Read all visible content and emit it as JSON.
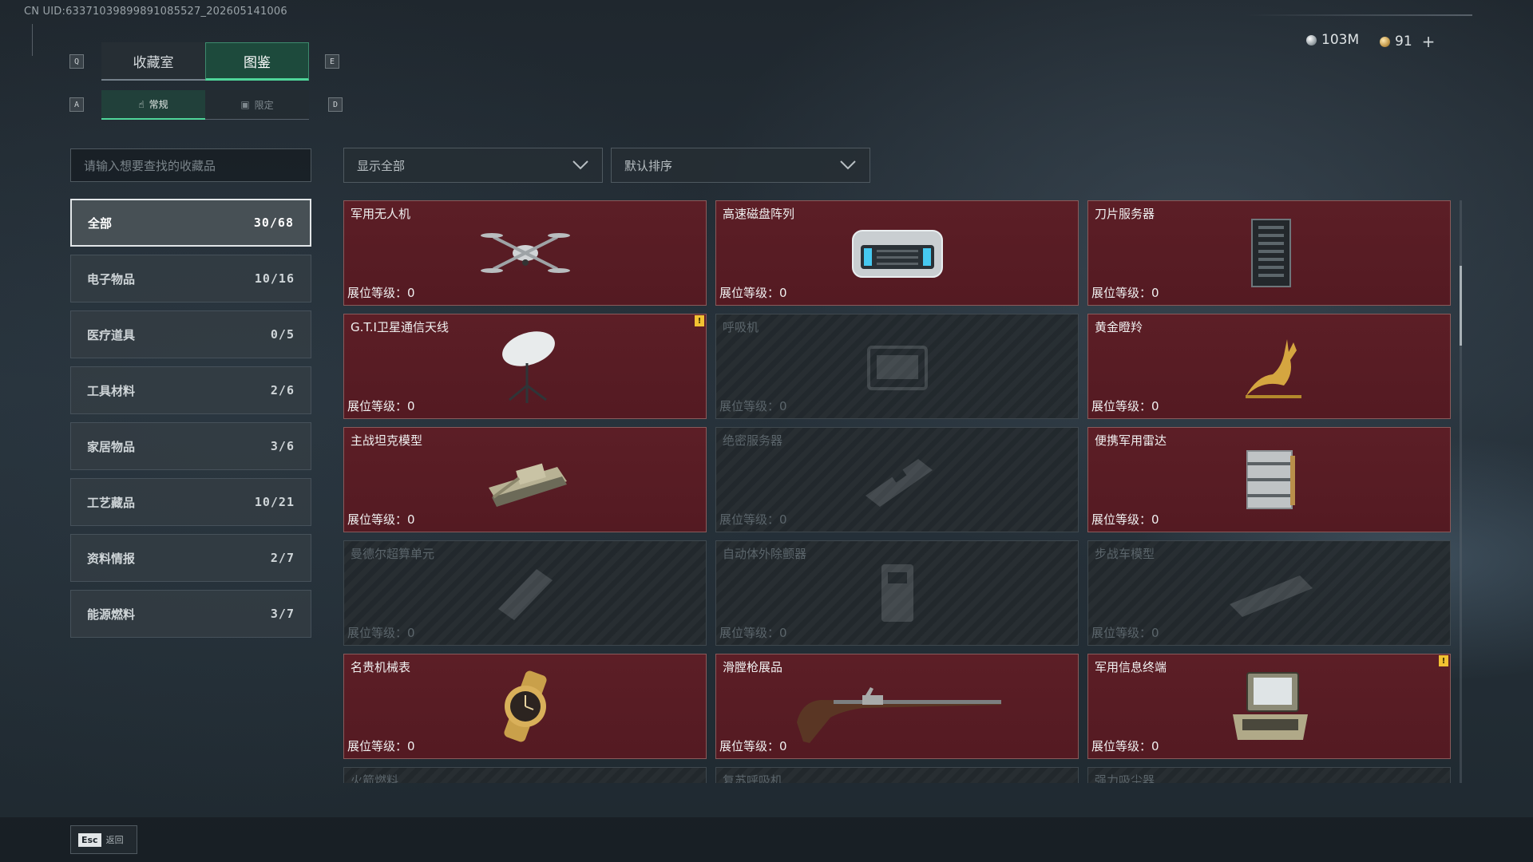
{
  "uid": "CN UID:63371039899891085527_202605141006",
  "keys": {
    "q": "Q",
    "e": "E",
    "a": "A",
    "d": "D"
  },
  "tabs": [
    {
      "label": "收藏室",
      "active": false
    },
    {
      "label": "图鉴",
      "active": true
    }
  ],
  "subtabs": [
    {
      "label": "常规",
      "icon": "hand-icon",
      "active": true
    },
    {
      "label": "限定",
      "icon": "frame-icon",
      "active": false
    }
  ],
  "currency": {
    "silver": "103M",
    "gold": "91",
    "plus": "+"
  },
  "search": {
    "placeholder": "请输入想要查找的收藏品"
  },
  "filters": {
    "display": "显示全部",
    "sort": "默认排序"
  },
  "categories": [
    {
      "label": "全部",
      "count": "30/68",
      "active": true
    },
    {
      "label": "电子物品",
      "count": "10/16",
      "active": false
    },
    {
      "label": "医疗道具",
      "count": "0/5",
      "active": false
    },
    {
      "label": "工具材料",
      "count": "2/6",
      "active": false
    },
    {
      "label": "家居物品",
      "count": "3/6",
      "active": false
    },
    {
      "label": "工艺藏品",
      "count": "10/21",
      "active": false
    },
    {
      "label": "资料情报",
      "count": "2/7",
      "active": false
    },
    {
      "label": "能源燃料",
      "count": "3/7",
      "active": false
    }
  ],
  "items": [
    {
      "name": "军用无人机",
      "level": "展位等级：0",
      "owned": true,
      "icon": "drone-icon",
      "flag": false
    },
    {
      "name": "高速磁盘阵列",
      "level": "展位等级：0",
      "owned": true,
      "icon": "disk-array-icon",
      "flag": false
    },
    {
      "name": "刀片服务器",
      "level": "展位等级：0",
      "owned": true,
      "icon": "server-icon",
      "flag": false
    },
    {
      "name": "G.T.I卫星通信天线",
      "level": "展位等级：0",
      "owned": true,
      "icon": "satellite-dish-icon",
      "flag": true
    },
    {
      "name": "呼吸机",
      "level": "展位等级：0",
      "owned": false,
      "icon": "ventilator-icon",
      "flag": false
    },
    {
      "name": "黄金瞪羚",
      "level": "展位等级：0",
      "owned": true,
      "icon": "gazelle-icon",
      "flag": false
    },
    {
      "name": "主战坦克模型",
      "level": "展位等级：0",
      "owned": true,
      "icon": "tank-icon",
      "flag": false
    },
    {
      "name": "绝密服务器",
      "level": "展位等级：0",
      "owned": false,
      "icon": "secret-server-icon",
      "flag": false
    },
    {
      "name": "便携军用雷达",
      "level": "展位等级：0",
      "owned": true,
      "icon": "radar-icon",
      "flag": false
    },
    {
      "name": "曼德尔超算单元",
      "level": "展位等级：0",
      "owned": false,
      "icon": "supercomputer-icon",
      "flag": false
    },
    {
      "name": "自动体外除颤器",
      "level": "展位等级：0",
      "owned": false,
      "icon": "defibrillator-icon",
      "flag": false
    },
    {
      "name": "步战车模型",
      "level": "展位等级：0",
      "owned": false,
      "icon": "ifv-icon",
      "flag": false
    },
    {
      "name": "名贵机械表",
      "level": "展位等级：0",
      "owned": true,
      "icon": "watch-icon",
      "flag": false
    },
    {
      "name": "滑膛枪展品",
      "level": "展位等级：0",
      "owned": true,
      "icon": "musket-icon",
      "flag": false
    },
    {
      "name": "军用信息终端",
      "level": "展位等级：0",
      "owned": true,
      "icon": "terminal-icon",
      "flag": true
    },
    {
      "name": "火箭燃料",
      "level": "",
      "owned": false,
      "icon": "",
      "flag": false
    },
    {
      "name": "复苏呼吸机",
      "level": "",
      "owned": false,
      "icon": "",
      "flag": false
    },
    {
      "name": "强力吸尘器",
      "level": "",
      "owned": false,
      "icon": "",
      "flag": false
    }
  ],
  "flag_text": "!",
  "footer": {
    "esc_key": "Esc",
    "back_label": "返回"
  },
  "colors": {
    "accent": "#4fd69a",
    "owned_card": "#5c1e26",
    "flag": "#f2c232"
  }
}
